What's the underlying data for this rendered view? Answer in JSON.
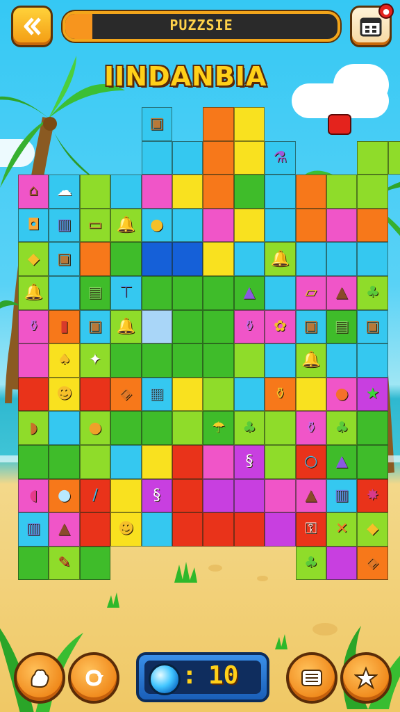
{
  "header": {
    "title": "PUZZSIE",
    "progress": 0.1,
    "back_icon": "double-chevron-left-icon",
    "menu_icon": "calendar-menu-icon",
    "notification_badge": "●"
  },
  "level_title": "IINDANBIA",
  "board": {
    "rows": [
      [
        "",
        "",
        "",
        "",
        "box",
        "",
        "orange",
        "yellow",
        "",
        "",
        "",
        "",
        ""
      ],
      [
        "",
        "",
        "",
        "",
        "cyan",
        "cyan",
        "orange",
        "yellow",
        "potion",
        "",
        "",
        "lime",
        "lime"
      ],
      [
        "hut",
        "cream",
        "lime",
        "cyan",
        "pink",
        "yellow",
        "orange",
        "green",
        "cyan",
        "orange",
        "lime",
        "lime",
        ""
      ],
      [
        "lantern",
        "jar",
        "chest",
        "bell",
        "pot",
        "cyan",
        "pink",
        "yellow",
        "cyan",
        "orange",
        "pink",
        "orange",
        ""
      ],
      [
        "drop",
        "box",
        "orange",
        "green",
        "blue",
        "blue",
        "yellow",
        "cyan",
        "bell",
        "cyan",
        "cyan",
        "cyan",
        ""
      ],
      [
        "bell",
        "cyan",
        "robot",
        "lamp",
        "green",
        "green",
        "green",
        "cone",
        "cyan",
        "scroll",
        "hat",
        "tree",
        ""
      ],
      [
        "flask",
        "cup",
        "box",
        "bell",
        "light",
        "green",
        "green",
        "flask",
        "crab",
        "box",
        "robot",
        "box",
        ""
      ],
      [
        "pink",
        "chick",
        "sparkle",
        "green",
        "green",
        "green",
        "green",
        "lime",
        "cyan",
        "bell",
        "cyan",
        "cyan",
        ""
      ],
      [
        "red",
        "pig",
        "red",
        "shield",
        "tower",
        "yellow",
        "lime",
        "cyan",
        "vase",
        "yellow",
        "balloon",
        "star",
        ""
      ],
      [
        "bread",
        "cyan",
        "apple",
        "green",
        "green",
        "lime",
        "umbrella",
        "tree",
        "lime",
        "flask",
        "tree",
        "green",
        ""
      ],
      [
        "green",
        "green",
        "lime",
        "cyan",
        "yellow",
        "red",
        "pink",
        "curl",
        "lime",
        "mirror",
        "cone",
        "green",
        ""
      ],
      [
        "lips",
        "circle",
        "needle",
        "yellow",
        "curl",
        "red",
        "magenta",
        "magenta",
        "pink",
        "hat",
        "jar",
        "bug",
        ""
      ],
      [
        "jar",
        "hat",
        "red",
        "pig",
        "cyan",
        "red",
        "red",
        "red",
        "magenta",
        "key",
        "cross",
        "drop",
        ""
      ],
      [
        "green",
        "meat",
        "green",
        "",
        "",
        "",
        "",
        "",
        "",
        "tree",
        "magenta",
        "shield",
        ""
      ]
    ]
  },
  "controls": {
    "left_buttons": [
      "hand-icon",
      "refresh-icon"
    ],
    "right_buttons": [
      "list-icon",
      "star-icon"
    ],
    "counter_value": "10",
    "counter_colon": ":",
    "gem_icon": "gem-icon"
  },
  "colors": {
    "orange": "#f7781a",
    "yellow": "#f9e11f",
    "lime": "#8fdc2a",
    "green": "#3fbc2a",
    "cyan": "#35c8f0",
    "pink": "#f055c8",
    "magenta": "#c83fe0",
    "blue": "#1560d8",
    "red": "#e9331a",
    "light": "#a9d6f8"
  }
}
